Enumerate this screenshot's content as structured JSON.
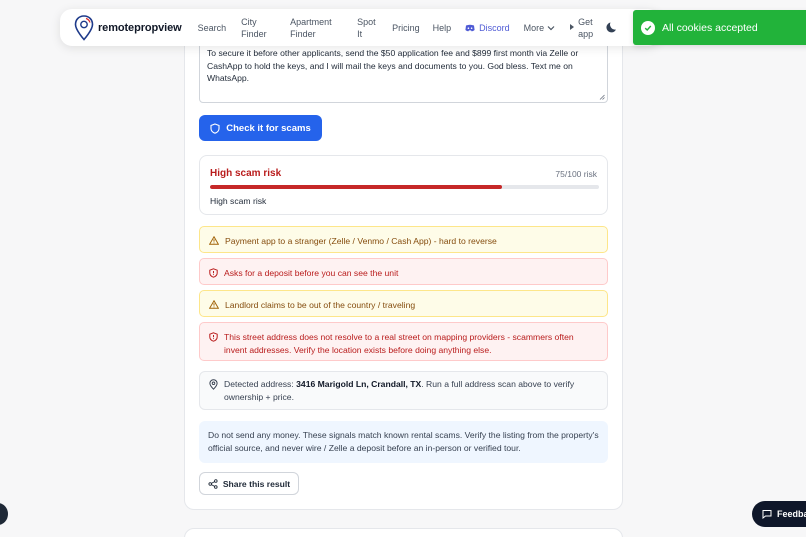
{
  "navbar": {
    "brand": "remotepropview",
    "links": [
      {
        "label": "Search"
      },
      {
        "label": "City Finder"
      },
      {
        "label": "Apartment Finder"
      },
      {
        "label": "Spot It"
      },
      {
        "label": "Pricing"
      },
      {
        "label": "Help"
      }
    ],
    "discord_label": "Discord",
    "more_label": "More",
    "get_app_label": "Get app"
  },
  "toast": {
    "message": "All cookies accepted",
    "color": "#22b33a"
  },
  "listing_text": "To secure it before other applicants, send the $50 application fee and $899 first month via Zelle or CashApp to hold the keys, and I will mail the keys and documents to you. God bless. Text me on WhatsApp.",
  "check_button_label": "Check it for scams",
  "risk": {
    "title": "High scam risk",
    "score_text": "75/100 risk",
    "score": 75,
    "max": 100,
    "summary": "High scam risk",
    "color": "#c62828"
  },
  "alerts": [
    {
      "type": "warning",
      "text": "Payment app to a stranger (Zelle / Venmo / Cash App) - hard to reverse"
    },
    {
      "type": "danger",
      "text": "Asks for a deposit before you can see the unit"
    },
    {
      "type": "warning",
      "text": "Landlord claims to be out of the country / traveling"
    },
    {
      "type": "danger",
      "text": "This street address does not resolve to a real street on mapping providers - scammers often invent addresses. Verify the location exists before doing anything else."
    }
  ],
  "address": {
    "prefix": "Detected address: ",
    "value": "3416 Marigold Ln, Crandall, TX",
    "suffix": ". Run a full address scan above to verify ownership + price."
  },
  "advice": "Do not send any money. These signals match known rental scams. Verify the listing from the property's official source, and never wire / Zelle a deposit before an in-person or verified tour.",
  "share_label": "Share this result",
  "feedback_label": "Feedback",
  "colors": {
    "primary": "#2563eb",
    "danger": "#b91c1c",
    "warning": "#854d0e"
  }
}
